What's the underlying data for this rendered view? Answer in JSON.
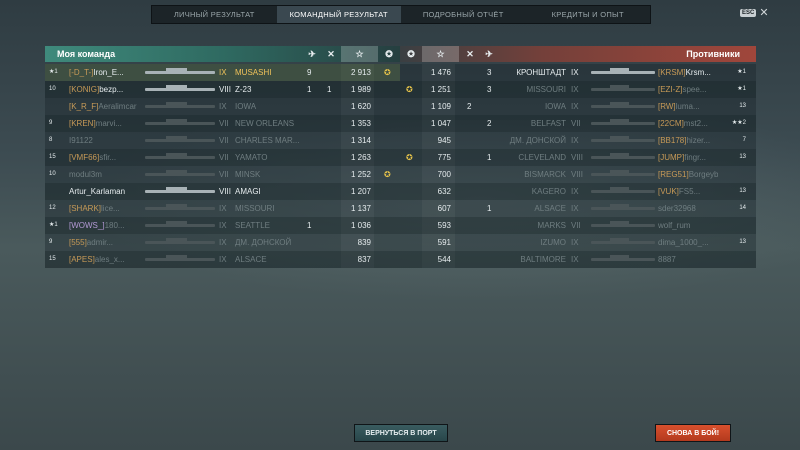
{
  "tabs": [
    "ЛИЧНЫЙ РЕЗУЛЬТАТ",
    "КОМАНДНЫЙ РЕЗУЛЬТАТ",
    "ПОДРОБНЫЙ ОТЧЁТ",
    "КРЕДИТЫ И ОПЫТ"
  ],
  "active_tab": 1,
  "esc": {
    "key": "ESC",
    "close": "✕"
  },
  "left_team": {
    "title": "Моя команда",
    "columns": {
      "planes": "✈",
      "kills": "✕",
      "star": "☆",
      "medal": "✪"
    },
    "rows": [
      {
        "rank": "★1",
        "clan": "[-D_T-]",
        "name": "Iron_E...",
        "tier": "IX",
        "ship": "MUSASHI",
        "planes": "9",
        "kills": "",
        "score": "2 913",
        "medal": "✪",
        "dim": false,
        "me": true
      },
      {
        "rank": "10",
        "clan": "[KONIG]",
        "name": "bezp...",
        "tier": "VIII",
        "ship": "Z-23",
        "planes": "1",
        "kills": "1",
        "score": "1 989",
        "medal": "",
        "dim": false
      },
      {
        "rank": "",
        "clan": "[K_R_F]",
        "name": "Aeralimcar",
        "tier": "IX",
        "ship": "IOWA",
        "planes": "",
        "kills": "",
        "score": "1 620",
        "medal": "",
        "dim": true
      },
      {
        "rank": "9",
        "clan": "[KREN]",
        "name": "marvi...",
        "tier": "VII",
        "ship": "NEW ORLEANS",
        "planes": "",
        "kills": "",
        "score": "1 353",
        "medal": "",
        "dim": true
      },
      {
        "rank": "8",
        "clan": "",
        "name": "I91122",
        "tier": "VII",
        "ship": "CHARLES MAR...",
        "planes": "",
        "kills": "",
        "score": "1 314",
        "medal": "",
        "dim": true
      },
      {
        "rank": "15",
        "clan": "[VMF66]",
        "name": "sfir...",
        "tier": "VII",
        "ship": "YAMATO",
        "planes": "",
        "kills": "",
        "score": "1 263",
        "medal": "",
        "dim": true
      },
      {
        "rank": "10",
        "clan": "",
        "name": "modul3m",
        "tier": "VII",
        "ship": "MINSK",
        "planes": "",
        "kills": "",
        "score": "1 252",
        "medal": "✪",
        "dim": true
      },
      {
        "rank": "",
        "clan": "",
        "name": "Artur_Karlaman",
        "tier": "VIII",
        "ship": "AMAGI",
        "planes": "",
        "kills": "",
        "score": "1 207",
        "medal": "",
        "dim": false
      },
      {
        "rank": "12",
        "clan": "[SHARK]",
        "name": "lice...",
        "tier": "IX",
        "ship": "MISSOURI",
        "planes": "",
        "kills": "",
        "score": "1 137",
        "medal": "",
        "dim": true
      },
      {
        "rank": "★1",
        "clan": "[WOWS_]",
        "name": "180...",
        "tier": "IX",
        "ship": "SEATTLE",
        "planes": "1",
        "kills": "",
        "score": "1 036",
        "medal": "",
        "dim": true
      },
      {
        "rank": "9",
        "clan": "[555]",
        "name": "admir...",
        "tier": "IX",
        "ship": "ДМ. ДОНСКОЙ",
        "planes": "",
        "kills": "",
        "score": "839",
        "medal": "",
        "dim": true
      },
      {
        "rank": "15",
        "clan": "[APES]",
        "name": "ales_x...",
        "tier": "IX",
        "ship": "ALSACE",
        "planes": "",
        "kills": "",
        "score": "837",
        "medal": "",
        "dim": true
      }
    ]
  },
  "right_team": {
    "title": "Противники",
    "rows": [
      {
        "medal": "",
        "score": "1 476",
        "kills": "",
        "planes": "3",
        "ship": "КРОНШТАДТ",
        "tier": "IX",
        "clan": "[KRSM]",
        "name": "Krsm...",
        "rank": "★1",
        "dim": false
      },
      {
        "medal": "✪",
        "score": "1 251",
        "kills": "",
        "planes": "3",
        "ship": "MISSOURI",
        "tier": "IX",
        "clan": "[EZI-Z]",
        "name": "spee...",
        "rank": "★1",
        "dim": true
      },
      {
        "medal": "",
        "score": "1 109",
        "kills": "2",
        "planes": "",
        "ship": "IOWA",
        "tier": "IX",
        "clan": "[RW]",
        "name": "luma...",
        "rank": "13",
        "dim": true
      },
      {
        "medal": "",
        "score": "1 047",
        "kills": "",
        "planes": "2",
        "ship": "BELFAST",
        "tier": "VII",
        "clan": "[22CM]",
        "name": "mst2...",
        "rank": "★★2",
        "dim": true
      },
      {
        "medal": "",
        "score": "945",
        "kills": "",
        "planes": "",
        "ship": "ДМ. ДОНСКОЙ",
        "tier": "IX",
        "clan": "[BB178]",
        "name": "hizer...",
        "rank": "7",
        "dim": true
      },
      {
        "medal": "✪",
        "score": "775",
        "kills": "",
        "planes": "1",
        "ship": "CLEVELAND",
        "tier": "VIII",
        "clan": "[JUMP]",
        "name": "fingr...",
        "rank": "13",
        "dim": true
      },
      {
        "medal": "",
        "score": "700",
        "kills": "",
        "planes": "",
        "ship": "BISMARCK",
        "tier": "VIII",
        "clan": "[REG51]",
        "name": "Borgeybod...",
        "rank": "",
        "dim": true
      },
      {
        "medal": "",
        "score": "632",
        "kills": "",
        "planes": "",
        "ship": "KAGERO",
        "tier": "IX",
        "clan": "[VUK]",
        "name": "FS5...",
        "rank": "13",
        "dim": true
      },
      {
        "medal": "",
        "score": "607",
        "kills": "",
        "planes": "1",
        "ship": "ALSACE",
        "tier": "IX",
        "clan": "",
        "name": "sder32968",
        "rank": "14",
        "dim": true
      },
      {
        "medal": "",
        "score": "593",
        "kills": "",
        "planes": "",
        "ship": "MARKS",
        "tier": "VII",
        "clan": "",
        "name": "wolf_rum",
        "rank": "",
        "dim": true
      },
      {
        "medal": "",
        "score": "591",
        "kills": "",
        "planes": "",
        "ship": "IZUMO",
        "tier": "IX",
        "clan": "",
        "name": "dima_1000_...",
        "rank": "13",
        "dim": true
      },
      {
        "medal": "",
        "score": "544",
        "kills": "",
        "planes": "",
        "ship": "BALTIMORE",
        "tier": "IX",
        "clan": "",
        "name": "8887",
        "rank": "",
        "dim": true
      }
    ]
  },
  "buttons": {
    "port": "ВЕРНУТЬСЯ В ПОРТ",
    "battle": "СНОВА В БОЙ!"
  }
}
